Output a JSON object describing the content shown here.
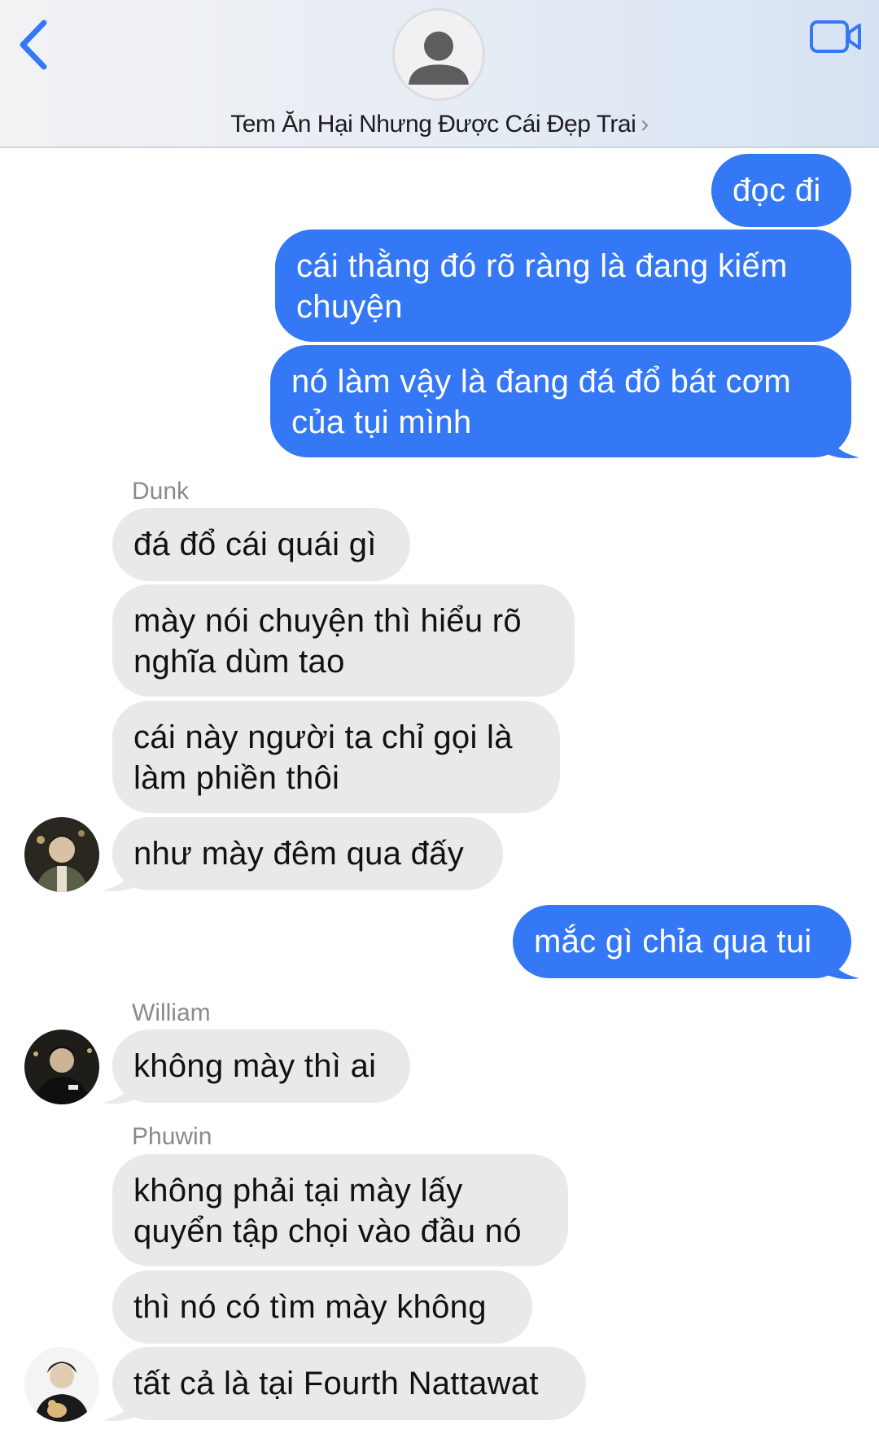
{
  "header": {
    "contact_name": "Tem Ăn Hại Nhưng Được Cái Đẹp Trai",
    "chevron": "›",
    "icons": {
      "back": "chevron-left-icon",
      "video": "video-camera-icon",
      "avatar": "person-silhouette-icon"
    },
    "accent_color": "#3478f6"
  },
  "colors": {
    "sent_bubble": "#3478f6",
    "received_bubble": "#e9e9eb"
  },
  "messages": {
    "m1": "đọc đi",
    "m2": "cái thằng đó rõ ràng là đang kiếm chuyện",
    "m3": "nó làm vậy là đang đá đổ bát cơm của tụi mình",
    "s1": "Dunk",
    "m4": "đá đổ cái quái gì",
    "m5": "mày nói chuyện thì hiểu rõ nghĩa dùm tao",
    "m6": "cái này người ta chỉ gọi là làm phiền thôi",
    "m7": "như mày đêm qua đấy",
    "m8": "mắc gì chỉa qua tui",
    "s2": "William",
    "m9": "không mày thì ai",
    "s3": "Phuwin",
    "m10": "không phải tại mày lấy quyển tập chọi vào đầu nó",
    "m11": "thì nó có tìm mày không",
    "m12": "tất cả là tại Fourth Nattawat"
  }
}
